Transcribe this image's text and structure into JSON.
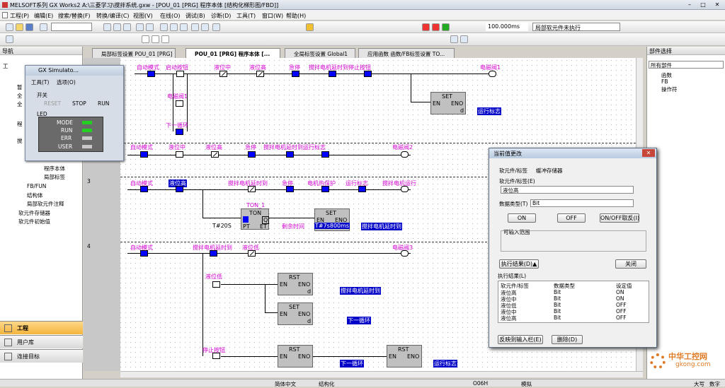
{
  "window": {
    "title": "MELSOFT系列 GX Works2 A:\\三菱学习\\搅拌系统.gxw - [POU_01 [PRG] 程序本体 [结构化梯形图/FBD]]"
  },
  "menu": [
    "工程(P)",
    "编辑(E)",
    "搜索/替换(F)",
    "转换/编译(C)",
    "视图(V)",
    "在线(O)",
    "调试(B)",
    "诊断(D)",
    "工具(T)",
    "窗口(W)",
    "帮助(H)"
  ],
  "toolbar": {
    "scan_time": "100.000ms",
    "exec_status": "局部软元件未执行"
  },
  "left_pane": {
    "title": "导航",
    "tree": [
      "工",
      "暂",
      "全",
      "全",
      "程",
      "搅",
      "程序本体",
      "局部标签",
      "FB/FUN",
      "结构体",
      "局部软元件注释",
      "软元件存储器",
      "软元件初始值"
    ]
  },
  "nav_buttons": [
    "工程",
    "用户库",
    "连接目标"
  ],
  "tabs": [
    "局部标签设置 POU_01 [PRG]",
    "POU_01 [PRG] 程序本体 [...",
    "全局标签设置 Global1",
    "应用函数 函数/FB标签设置 TO..."
  ],
  "right_pane": {
    "title": "部件选择",
    "dropdown": "所有部件",
    "tree": [
      "函数",
      "FB",
      "操作符"
    ]
  },
  "simulator": {
    "title": "GX Simulato...",
    "menu": [
      "工具(T)",
      "选项(O)"
    ],
    "switch_label": "开关",
    "modes": [
      "RESET",
      "STOP",
      "RUN"
    ],
    "led_label": "LED",
    "leds": [
      "MODE",
      "RUN",
      "ERR",
      "USER"
    ],
    "led_state": [
      1,
      1,
      0,
      0
    ]
  },
  "ladder": {
    "rung_numbers": [
      "3",
      "4"
    ],
    "r1": [
      "自动模式",
      "启动按钮",
      "液位中",
      "液位高",
      "急停",
      "搅拌电机延时到停止按钮",
      "电磁阀1",
      "电磁阀1",
      "下一循环",
      "运行标志"
    ],
    "r2": [
      "自动模式",
      "液位中",
      "液位高",
      "急停",
      "搅拌电机延时到运行标志",
      "电磁阀2"
    ],
    "r3": [
      "自动模式",
      "液位高",
      "搅拌电机延时到",
      "急停",
      "电机热保护",
      "运行标志",
      "搅拌电机运行",
      "TON_1",
      "T#20S",
      "剩余时间",
      "T#7s800ms",
      "搅拌电机延时到"
    ],
    "r4": [
      "自动模式",
      "搅拌电机延时到",
      "液位低",
      "电磁阀3",
      "液位低",
      "搅拌电机延时到",
      "下一循环",
      "停止按钮",
      "下一循环",
      "运行标志"
    ],
    "fb": {
      "set": "SET",
      "rst": "RST",
      "ton": "TON",
      "en": "EN",
      "eno": "ENO",
      "d": "d",
      "pt": "PT",
      "et": "ET",
      "in": "IN",
      "q": "Q"
    }
  },
  "dialog": {
    "title": "当前值更改",
    "tabs": [
      "软元件/标签",
      "缓冲存储器"
    ],
    "device_label": "软元件/标签(E)",
    "device_value": "液位高",
    "type_label": "数据类型(T)",
    "type_value": "Bit",
    "on": "ON",
    "off": "OFF",
    "toggle": "ON/OFF取反(I)",
    "range_label": "可输入范围",
    "history_btn": "执行结果(D)▲",
    "close_btn": "关闭",
    "history_label": "执行结果(L)",
    "headers": [
      "软元件/标签",
      "数据类型",
      "设定值"
    ],
    "rows": [
      [
        "液位高",
        "Bit",
        "ON"
      ],
      [
        "液位中",
        "Bit",
        "ON"
      ],
      [
        "液位低",
        "Bit",
        "OFF"
      ],
      [
        "液位中",
        "Bit",
        "OFF"
      ],
      [
        "液位高",
        "Bit",
        "OFF"
      ]
    ],
    "reflect_btn": "反映到输入栏(E)",
    "delete_btn": "删除(D)"
  },
  "status": [
    "简体中文",
    "结构化",
    "O06H",
    "模拟",
    "大写",
    "数字"
  ],
  "watermark": {
    "cn": "中华工控网",
    "url": "gkong.com"
  }
}
